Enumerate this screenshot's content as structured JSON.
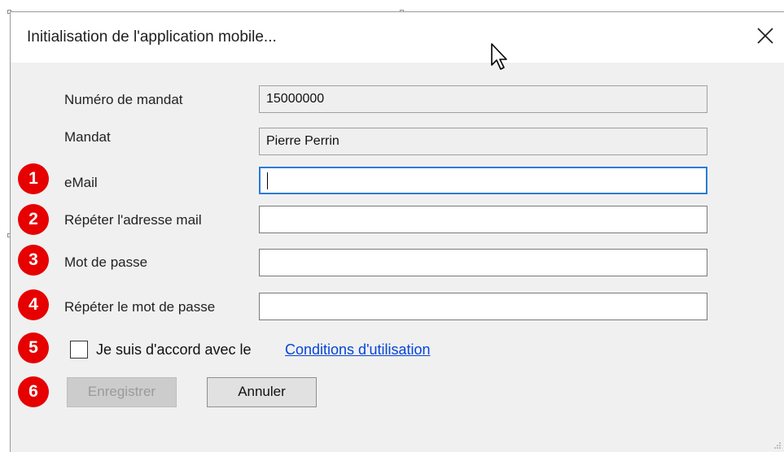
{
  "window": {
    "title": "Initialisation de l'application mobile..."
  },
  "form": {
    "mandat_number": {
      "label": "Numéro de mandat",
      "value": "15000000"
    },
    "mandat": {
      "label": "Mandat",
      "value": "Pierre Perrin"
    },
    "email": {
      "label": "eMail",
      "value": ""
    },
    "repeat_email": {
      "label": "Répéter l'adresse mail",
      "value": ""
    },
    "password": {
      "label": "Mot de passe",
      "value": ""
    },
    "repeat_password": {
      "label": "Répéter le mot de passe",
      "value": ""
    },
    "agreement": {
      "text": "Je suis d'accord avec le",
      "link": "Conditions d'utilisation",
      "checked": false
    }
  },
  "buttons": {
    "save": "Enregistrer",
    "cancel": "Annuler"
  },
  "badges": [
    "1",
    "2",
    "3",
    "4",
    "5",
    "6"
  ],
  "colors": {
    "badge": "#e60000",
    "link": "#0645d8",
    "focus_border": "#2b7bd6"
  },
  "icons": {
    "close": "close-icon",
    "cursor": "mouse-pointer-icon"
  }
}
